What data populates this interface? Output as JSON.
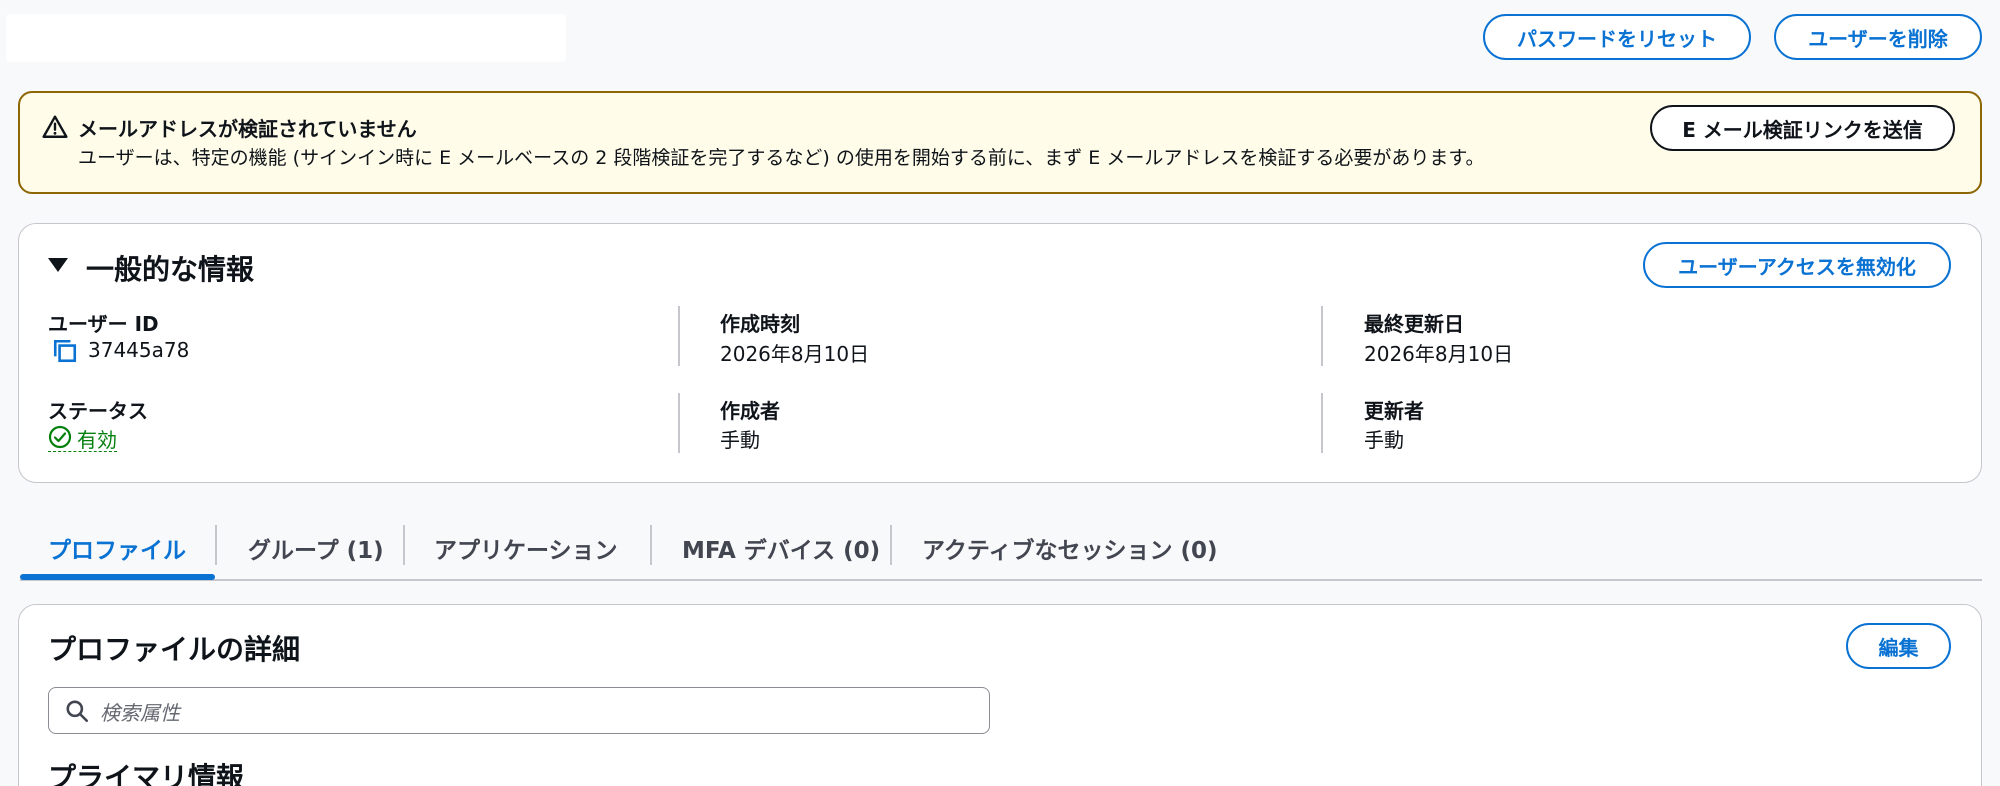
{
  "header": {
    "reset_password_button": "パスワードをリセット",
    "delete_user_button": "ユーザーを削除"
  },
  "banner": {
    "title": "メールアドレスが検証されていません",
    "message": "ユーザーは、特定の機能 (サインイン時に E メールベースの 2 段階検証を完了するなど) の使用を開始する前に、まず E メールアドレスを検証する必要があります。",
    "send_link_button": "E メール検証リンクを送信",
    "icon": "warning-icon",
    "color": "#8d6605"
  },
  "general_info": {
    "title": "一般的な情報",
    "disable_access_button": "ユーザーアクセスを無効化",
    "user_id": {
      "label": "ユーザー ID",
      "value": "37445a78"
    },
    "created_at": {
      "label": "作成時刻",
      "value": "2026年8月10日"
    },
    "updated_at": {
      "label": "最終更新日",
      "value": "2026年8月10日"
    },
    "status": {
      "label": "ステータス",
      "value": "有効",
      "color": "#037f0c"
    },
    "created_by": {
      "label": "作成者",
      "value": "手動"
    },
    "updated_by": {
      "label": "更新者",
      "value": "手動"
    }
  },
  "tabs": [
    {
      "label": "プロファイル",
      "active": true
    },
    {
      "label": "グループ (1)",
      "active": false
    },
    {
      "label": "アプリケーション",
      "active": false
    },
    {
      "label": "MFA デバイス (0)",
      "active": false
    },
    {
      "label": "アクティブなセッション (0)",
      "active": false
    }
  ],
  "profile": {
    "title": "プロファイルの詳細",
    "edit_button": "編集",
    "search_placeholder": "検索属性",
    "primary_section_title": "プライマリ情報"
  },
  "colors": {
    "accent": "#0972d3",
    "text": "#0f141a",
    "border": "#c6c6cd",
    "background": "#f8f9fb"
  }
}
